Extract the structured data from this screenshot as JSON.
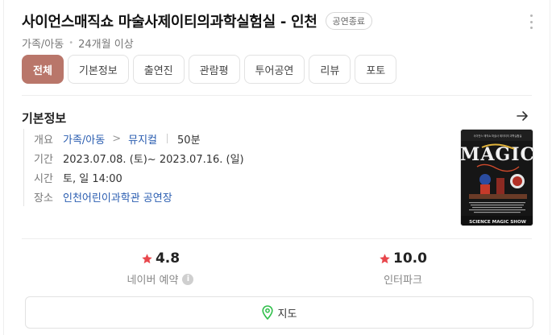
{
  "header": {
    "title": "사이언스매직쇼 마술사제이티의과학실험실 - 인천",
    "status_badge": "공연종료",
    "genre": "가족/아동",
    "age": "24개월 이상"
  },
  "tabs": [
    {
      "label": "전체",
      "active": true
    },
    {
      "label": "기본정보",
      "active": false
    },
    {
      "label": "출연진",
      "active": false
    },
    {
      "label": "관람평",
      "active": false
    },
    {
      "label": "투어공연",
      "active": false
    },
    {
      "label": "리뷰",
      "active": false
    },
    {
      "label": "포토",
      "active": false
    }
  ],
  "basic_info": {
    "section_title": "기본정보",
    "overview_label": "개요",
    "category": "가족/아동",
    "breadcrumb_separator": ">",
    "subcategory": "뮤지컬",
    "runtime": "50분",
    "period_label": "기간",
    "period": "2023.07.08. (토)~ 2023.07.16. (일)",
    "time_label": "시간",
    "time": "토, 일 14:00",
    "venue_label": "장소",
    "venue": "인천어린이과학관 공연장"
  },
  "poster": {
    "top_text": "사이언스 매직쇼 마술사 제이티의 과학실험실",
    "main_text": "MAGIC",
    "bottom_text": "SCIENCE MAGIC SHOW"
  },
  "ratings": [
    {
      "score": "4.8",
      "provider": "네이버 예약"
    },
    {
      "score": "10.0",
      "provider": "인터파크"
    }
  ],
  "map_button": {
    "label": "지도"
  },
  "colors": {
    "accent": "#b9766a",
    "star": "#e8474c",
    "link": "#2a5db0",
    "map_pin": "#2fbf4a"
  }
}
